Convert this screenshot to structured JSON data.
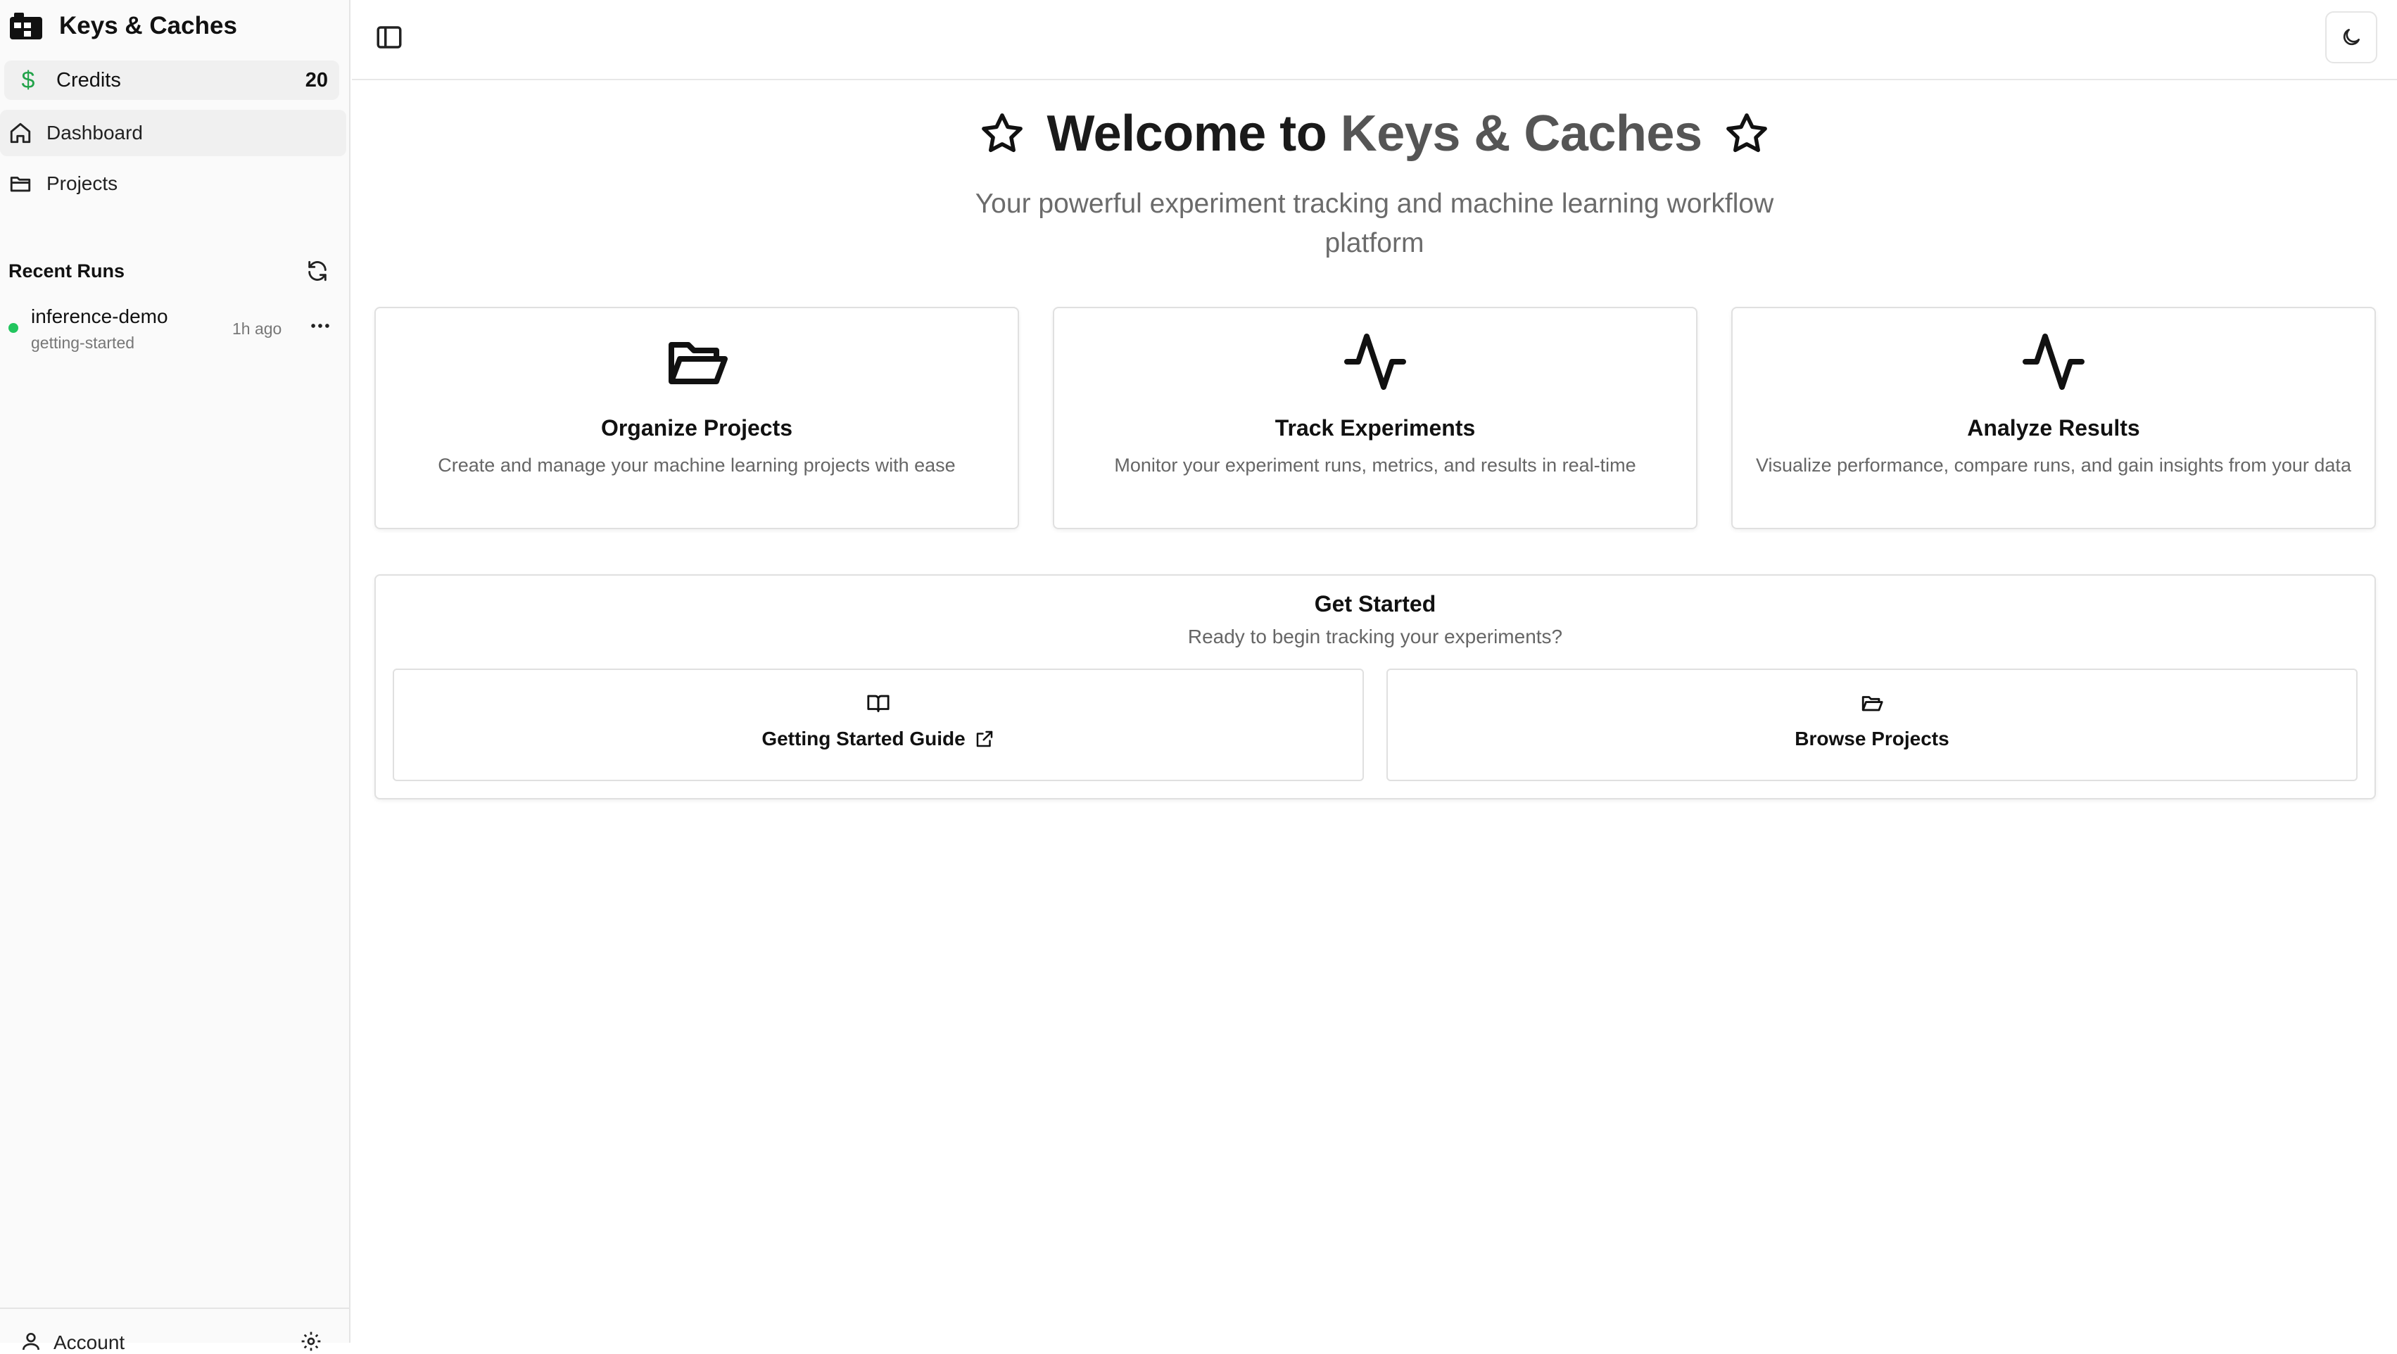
{
  "sidebar": {
    "brand": "Keys & Caches",
    "credits": {
      "label": "Credits",
      "value": "20"
    },
    "nav": [
      {
        "label": "Dashboard",
        "icon": "home-icon"
      },
      {
        "label": "Projects",
        "icon": "folder-icon"
      }
    ],
    "recent_runs": {
      "title": "Recent Runs",
      "items": [
        {
          "name": "inference-demo",
          "project": "getting-started",
          "time": "1h ago",
          "status_color": "#22c55e"
        }
      ]
    },
    "account": {
      "label": "Account"
    }
  },
  "hero": {
    "title_prefix": "Welcome to ",
    "title_brand": "Keys & Caches",
    "subtitle": "Your powerful experiment tracking and machine learning workflow platform"
  },
  "features": [
    {
      "title": "Organize Projects",
      "description": "Create and manage your machine learning projects with ease",
      "icon": "folder-open-icon"
    },
    {
      "title": "Track Experiments",
      "description": "Monitor your experiment runs, metrics, and results in real-time",
      "icon": "activity-icon"
    },
    {
      "title": "Analyze Results",
      "description": "Visualize performance, compare runs, and gain insights from your data",
      "icon": "activity-icon"
    }
  ],
  "get_started": {
    "title": "Get Started",
    "subtitle": "Ready to begin tracking your experiments?",
    "guide_label": "Getting Started Guide",
    "browse_label": "Browse Projects"
  },
  "colors": {
    "accent_green": "#22a34a",
    "status_green": "#22c55e"
  }
}
